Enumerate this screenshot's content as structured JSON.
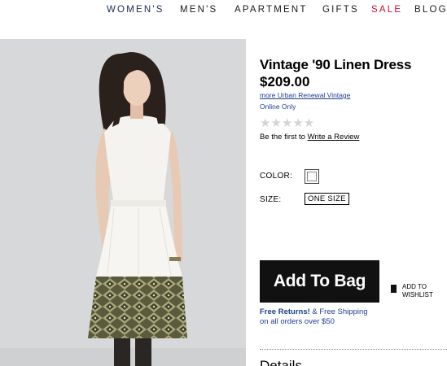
{
  "nav": {
    "womens": "WOMEN'S",
    "mens": "MEN'S",
    "apartment": "APARTMENT",
    "gifts": "GIFTS",
    "sale": "SALE",
    "blog": "BLOG"
  },
  "product": {
    "title": "Vintage '90 Linen Dress",
    "price": "$209.00",
    "collection_link": "more Urban Renewal Vintage",
    "availability": "Online Only",
    "rating_stars": "★★★★★",
    "review_prompt": "Be the first to",
    "review_link": "Write a Review",
    "color_label": "COLOR:",
    "size_label": "SIZE:",
    "size_value": "ONE SIZE",
    "add_to_bag": "Add To Bag",
    "wishlist": "ADD TO\nWISHLIST",
    "returns_bold": "Free Returns!",
    "shipping_rest": " & Free Shipping\non all orders over $50",
    "details_heading": "Details"
  },
  "colors": {
    "sale": "#c8102e",
    "link": "#1d3f8f",
    "button": "#111111",
    "photo_bg": "#d7d8da"
  },
  "icons": {
    "wishlist": "bookmark-icon",
    "rating": "star-icon"
  }
}
